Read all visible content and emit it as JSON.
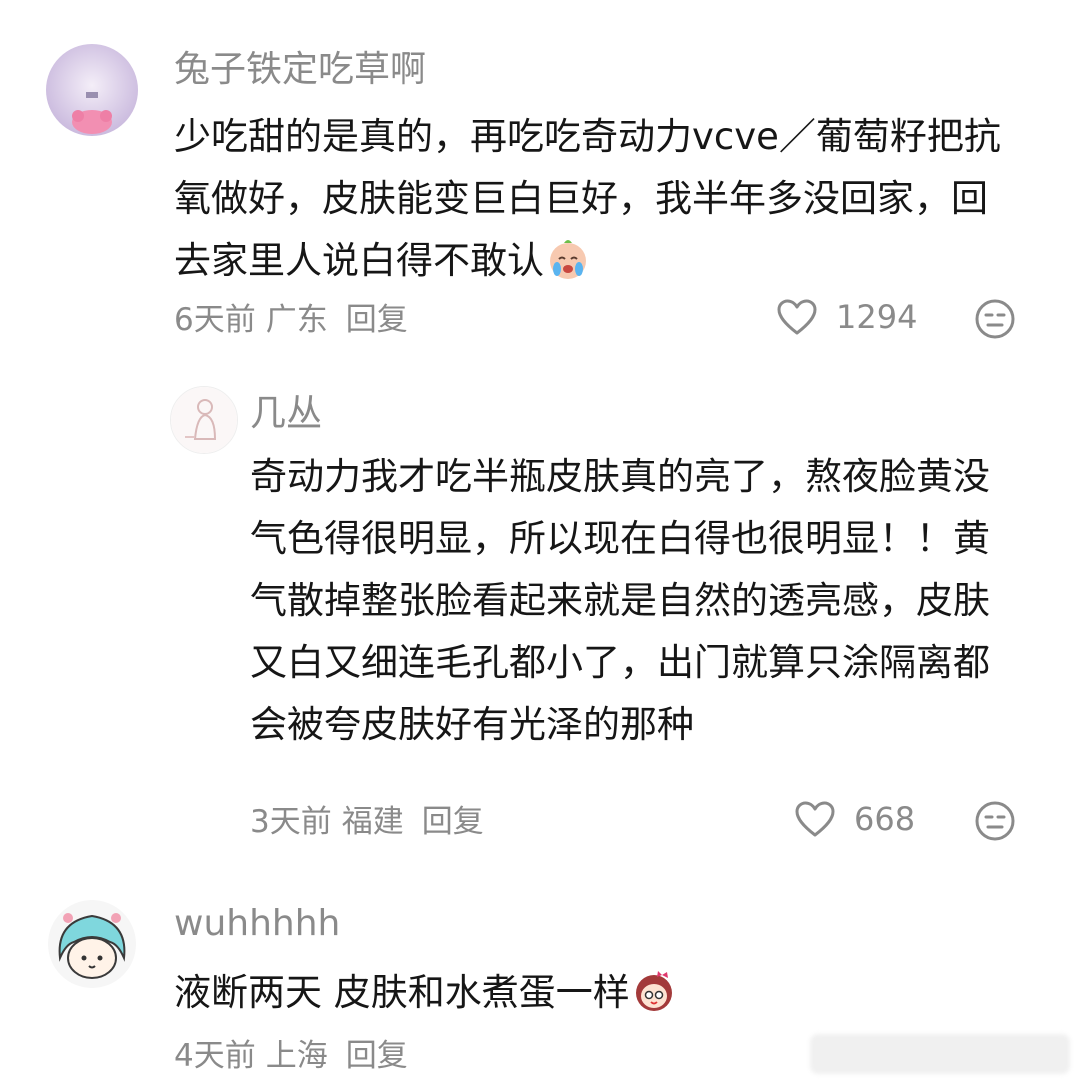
{
  "comments": [
    {
      "username": "兔子铁定吃草啊",
      "text": "少吃甜的是真的，再吃吃奇动力vcve／葡萄籽把抗氧做好，皮肤能变巨白巨好，我半年多没回家，回去家里人说白得不敢认",
      "emoji_icon": "crying-face-emoji",
      "time": "6天前",
      "location": "广东",
      "reply_label": "回复",
      "likes": "1294"
    },
    {
      "username": "几丛",
      "text": "奇动力我才吃半瓶皮肤真的亮了，熬夜脸黄没气色得很明显，所以现在白得也很明显！！黄气散掉整张脸看起来就是自然的透亮感，皮肤又白又细连毛孔都小了，出门就算只涂隔离都会被夸皮肤好有光泽的那种",
      "time": "3天前",
      "location": "福建",
      "reply_label": "回复",
      "likes": "668"
    },
    {
      "username": "wuhhhhh",
      "text": "液断两天 皮肤和水煮蛋一样",
      "emoji_icon": "girl-face-emoji",
      "time": "4天前",
      "location": "上海",
      "reply_label": "回复"
    }
  ],
  "icons": {
    "like": "heart-outline-icon",
    "dislike": "meh-face-icon"
  },
  "colors": {
    "meta_text": "#8a8a8a",
    "body_text": "#161616",
    "background": "#ffffff"
  }
}
